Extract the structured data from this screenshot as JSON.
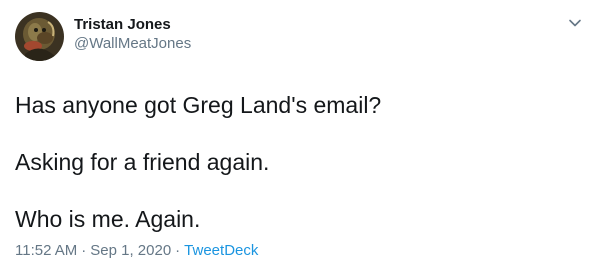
{
  "author": {
    "display_name": "Tristan Jones",
    "handle": "@WallMeatJones"
  },
  "tweet": {
    "lines": [
      "Has anyone got Greg Land's email?",
      "Asking for a friend again.",
      "Who is me. Again."
    ],
    "time": "11:52 AM",
    "date": "Sep 1, 2020",
    "separator": "·",
    "source": "TweetDeck"
  },
  "colors": {
    "text": "#14171a",
    "muted": "#657786",
    "link": "#1b95e0"
  },
  "icons": {
    "menu": "chevron-down-icon"
  }
}
